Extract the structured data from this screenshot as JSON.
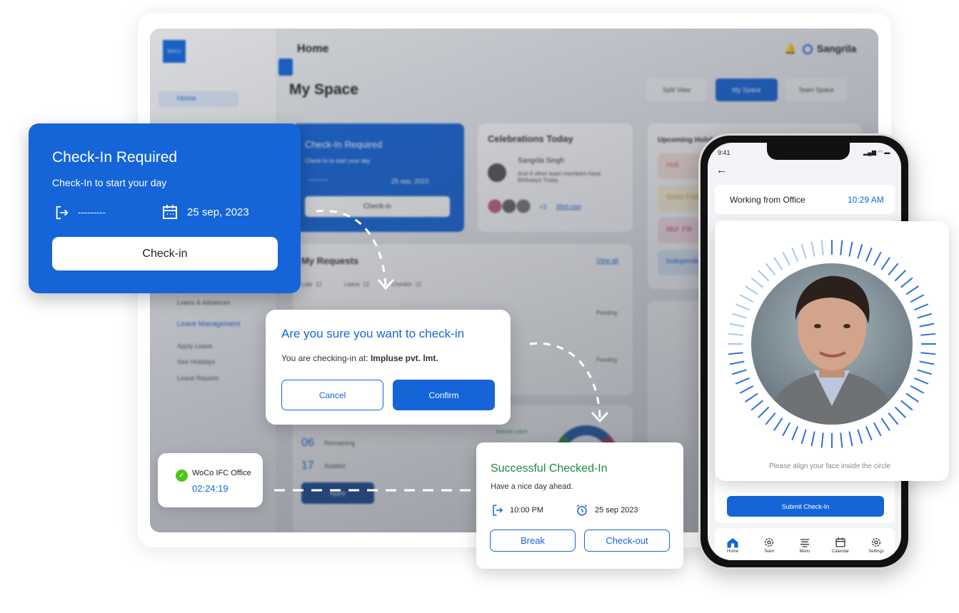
{
  "dashboard": {
    "logo": "WoCo",
    "header_title": "Home",
    "user_name": "Sangrila",
    "page_title": "My Space",
    "view_tabs": [
      "Split View",
      "My Space",
      "Team Space"
    ],
    "sidebar": {
      "items": [
        "Home",
        "Loans & Advances",
        "Leave Management",
        "Apply Leave",
        "See Holidays",
        "Leave Reports"
      ]
    },
    "checkin_card": {
      "title": "Check-In Required",
      "subtitle": "Check-In to start your day",
      "time": "---------",
      "date": "25 sep, 2023",
      "button": "Check-in"
    },
    "celebrations": {
      "title": "Celebrations Today",
      "name": "Sangrila Singh",
      "text": "And 4 other team members have Birthdays Today",
      "more": "+3",
      "link": "Wish now"
    },
    "requests": {
      "title": "My Requests",
      "view_all": "View all",
      "tabs": [
        {
          "label": "Late",
          "count": "12"
        },
        {
          "label": "Leave",
          "count": "12"
        },
        {
          "label": "Checkin",
          "count": "12"
        }
      ],
      "status": [
        "Pending",
        "Pending"
      ]
    },
    "leaves": {
      "remaining": "06",
      "remaining_label": "Remaining",
      "availed": "17",
      "availed_label": "Availed",
      "apply": "Apply",
      "legend": "Earned Leave"
    },
    "holidays": {
      "title": "Upcoming Holidays",
      "items": [
        "Holi",
        "Good Friday",
        "Idul- Fitr",
        "Independence Day"
      ]
    }
  },
  "checkin_popup": {
    "title": "Check-In Required",
    "subtitle": "Check-In to start your day",
    "time": "---------",
    "date": "25 sep, 2023",
    "button": "Check-in"
  },
  "confirm_dialog": {
    "title": "Are you sure you want to check-in",
    "message_prefix": "You are checking-in at: ",
    "location": "Impluse pvt. lmt.",
    "cancel": "Cancel",
    "confirm": "Confirm"
  },
  "office_badge": {
    "name": "WoCo IFC Office",
    "timer": "02:24:19"
  },
  "success_card": {
    "title": "Successful Checked-In",
    "subtitle": "Have a nice day ahead.",
    "time": "10:00 PM",
    "date": "25 sep 2023",
    "break": "Break",
    "checkout": "Check-out"
  },
  "phone": {
    "status_time": "9:41",
    "work_mode": "Working from Office",
    "clock": "10:29 AM",
    "face_hint": "Please align your face inside the circle",
    "submit": "Submit Check-In",
    "nav": [
      "Home",
      "Team",
      "Menu",
      "Calendar",
      "Settings"
    ],
    "active_nav": "Home"
  },
  "colors": {
    "primary": "#1565d8",
    "success": "#1f8a3b",
    "check": "#4cc417"
  }
}
